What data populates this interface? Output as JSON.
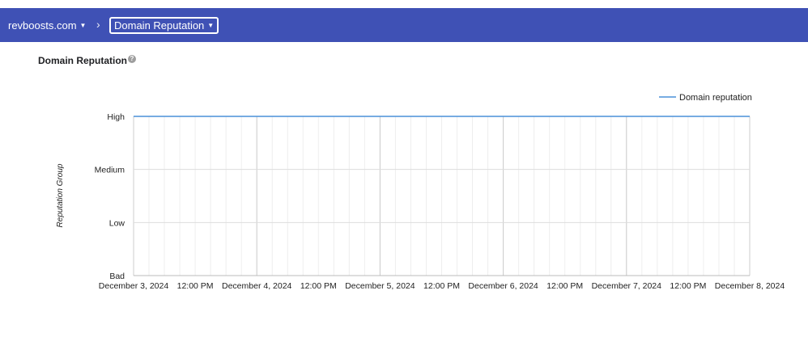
{
  "breadcrumb": {
    "domain": "revboosts.com",
    "separator": "›",
    "current": "Domain Reputation"
  },
  "section": {
    "title": "Domain Reputation",
    "help_icon": "question-circle-icon"
  },
  "chart_data": {
    "type": "line",
    "title": "",
    "ylabel": "Reputation Group",
    "xlabel": "",
    "y_categories": [
      "Bad",
      "Low",
      "Medium",
      "High"
    ],
    "x_tick_labels": [
      "December 3, 2024",
      "12:00 PM",
      "December 4, 2024",
      "12:00 PM",
      "December 5, 2024",
      "12:00 PM",
      "December 6, 2024",
      "12:00 PM",
      "December 7, 2024",
      "12:00 PM",
      "December 8, 2024"
    ],
    "xlim": [
      "2024-12-03T00:00",
      "2024-12-08T00:00"
    ],
    "grid": true,
    "legend_position": "top-right",
    "series": [
      {
        "name": "Domain reputation",
        "color": "#4a90d9",
        "points": [
          {
            "x": "2024-12-03T00:00",
            "y": "High"
          },
          {
            "x": "2024-12-08T00:00",
            "y": "High"
          }
        ]
      }
    ]
  }
}
